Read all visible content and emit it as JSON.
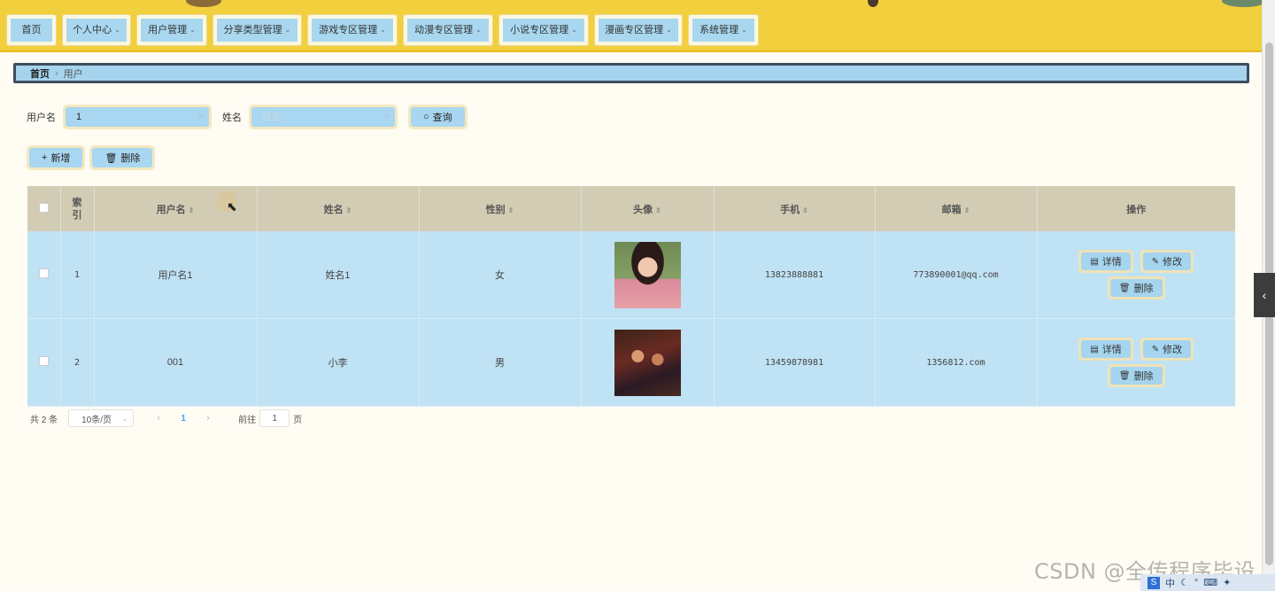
{
  "nav": [
    {
      "label": "首页",
      "dropdown": false,
      "width": 57
    },
    {
      "label": "个人中心",
      "dropdown": true,
      "width": 78
    },
    {
      "label": "用户管理",
      "dropdown": true,
      "width": 80
    },
    {
      "label": "分享类型管理",
      "dropdown": true,
      "width": 101
    },
    {
      "label": "游戏专区管理",
      "dropdown": true,
      "width": 102
    },
    {
      "label": "动漫专区管理",
      "dropdown": true,
      "width": 102
    },
    {
      "label": "小说专区管理",
      "dropdown": true,
      "width": 102
    },
    {
      "label": "漫画专区管理",
      "dropdown": true,
      "width": 100
    },
    {
      "label": "系统管理",
      "dropdown": true,
      "width": 80
    }
  ],
  "breadcrumb": {
    "home": "首页",
    "current": "用户"
  },
  "search": {
    "username_label": "用户名",
    "username_value": "1",
    "name_label": "姓名",
    "name_placeholder": "姓名",
    "query_label": "查询"
  },
  "actions": {
    "add_label": "新增",
    "delete_label": "删除"
  },
  "table": {
    "headers": {
      "index": "索引",
      "username": "用户名",
      "name": "姓名",
      "gender": "性别",
      "avatar": "头像",
      "phone": "手机",
      "email": "邮箱",
      "ops": "操作"
    },
    "rows": [
      {
        "index": "1",
        "username": "用户名1",
        "name": "姓名1",
        "gender": "女",
        "phone": "13823888881",
        "email": "773890001@qq.com"
      },
      {
        "index": "2",
        "username": "001",
        "name": "小李",
        "gender": "男",
        "phone": "13459878981",
        "email": "1356812.com"
      }
    ],
    "op_labels": {
      "detail": "详情",
      "edit": "修改",
      "delete": "删除"
    }
  },
  "pagination": {
    "total": "共 2 条",
    "page_size": "10条/页",
    "current_page": "1",
    "goto_label": "前往",
    "goto_value": "1",
    "page_suffix": "页"
  },
  "watermark": "CSDN @全传程序毕设",
  "taskbar": {
    "ime": "中"
  },
  "colors": {
    "nav_bg": "#f2cf3c",
    "button_bg": "#a9d6f0",
    "button_border": "#f4e8c0",
    "header_bg": "#d3ccb4",
    "row_bg": "#bfe2f4",
    "page_bg": "#fffcf3"
  },
  "icons": {
    "search": "search-icon",
    "add": "plus-icon",
    "delete": "trash-icon",
    "detail": "document-icon",
    "edit": "pencil-icon",
    "sort": "sort-icon",
    "collapse": "chevron-left-icon"
  }
}
